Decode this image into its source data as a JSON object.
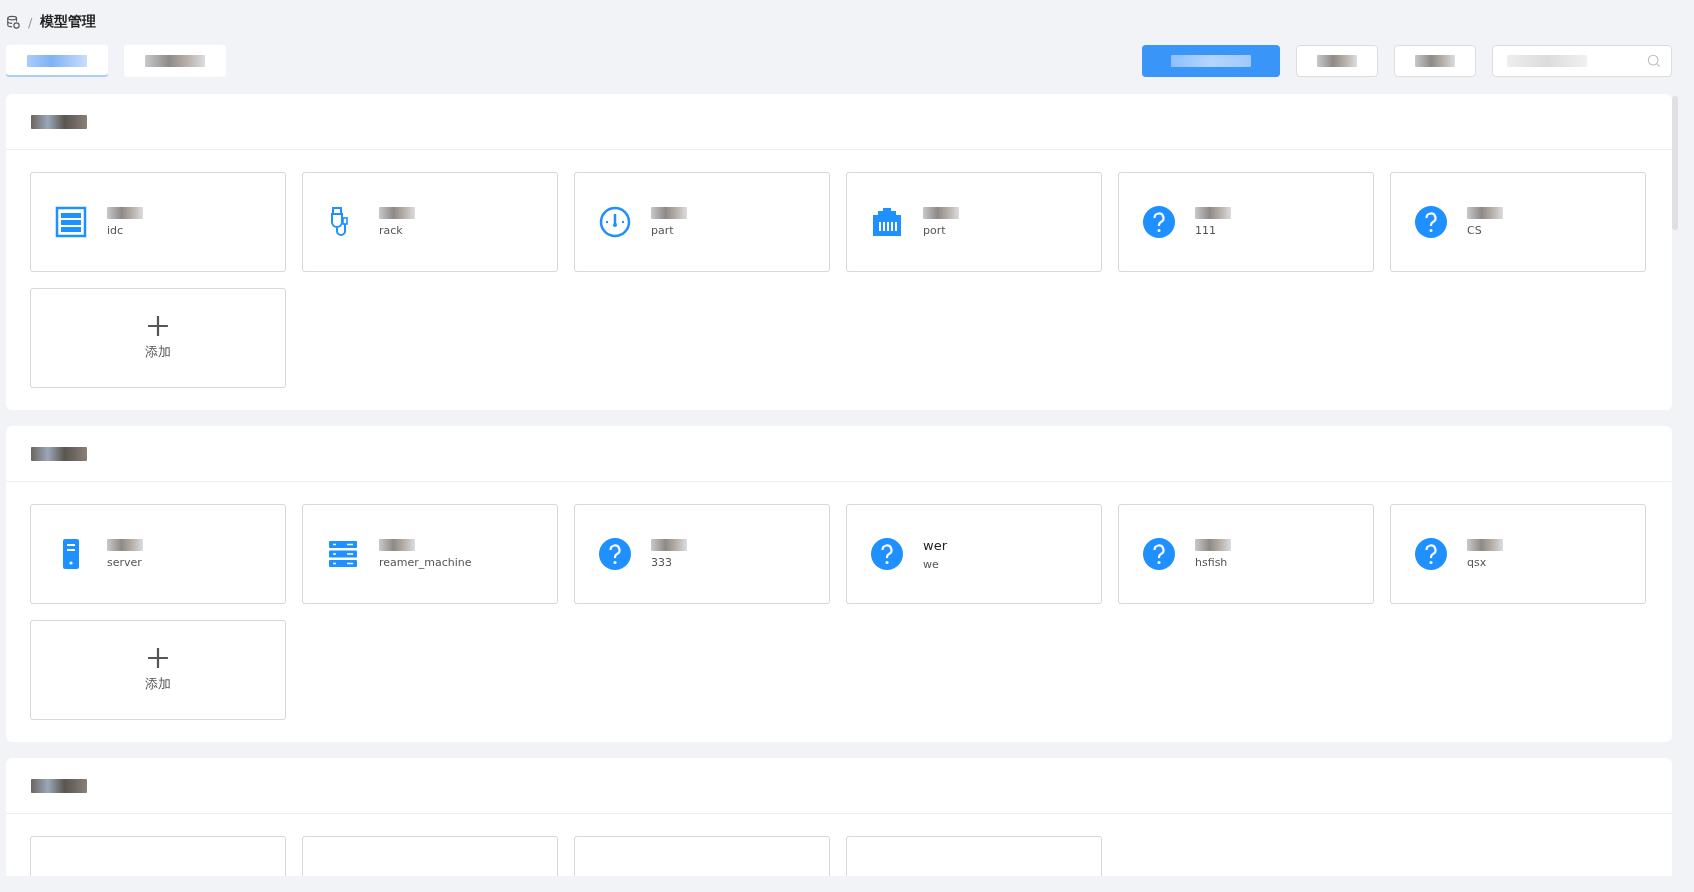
{
  "breadcrumb": {
    "separator": "/",
    "current": "模型管理"
  },
  "tabs": [
    {
      "selected": true
    },
    {
      "selected": false
    }
  ],
  "sections": [
    {
      "cards": [
        {
          "kind": "rack",
          "code": "idc"
        },
        {
          "kind": "usb",
          "code": "rack"
        },
        {
          "kind": "gauge",
          "code": "part"
        },
        {
          "kind": "ethernet",
          "code": "port"
        },
        {
          "kind": "question",
          "code": "111"
        },
        {
          "kind": "question",
          "code": "CS"
        }
      ],
      "add_label": "添加"
    },
    {
      "cards": [
        {
          "kind": "server",
          "code": "server"
        },
        {
          "kind": "units",
          "code": "reamer_machine"
        },
        {
          "kind": "question",
          "code": "333"
        },
        {
          "kind": "question",
          "name": "wer",
          "code": "we"
        },
        {
          "kind": "question",
          "code": "hsfish"
        },
        {
          "kind": "question",
          "code": "qsx"
        }
      ],
      "add_label": "添加"
    },
    {
      "cards": [
        {
          "kind": "clipped"
        },
        {
          "kind": "clipped"
        },
        {
          "kind": "clipped"
        },
        {
          "kind": "clipped"
        }
      ]
    }
  ]
}
